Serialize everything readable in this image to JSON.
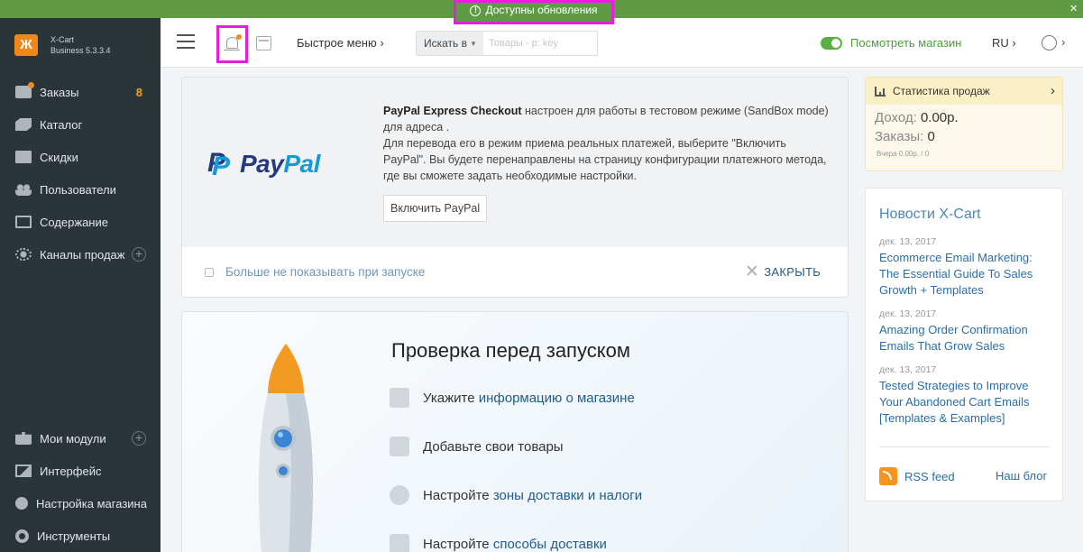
{
  "topbar": {
    "update_notice": "Доступны обновления",
    "close_glyph": "×"
  },
  "brand": {
    "logo_glyph": "Ж",
    "line1": "X-Cart",
    "line2": "Business 5.3.3.4"
  },
  "sidebar": {
    "items": [
      {
        "label": "Заказы",
        "badge": "8",
        "icon": "orders-icon"
      },
      {
        "label": "Каталог",
        "icon": "tag-icon"
      },
      {
        "label": "Скидки",
        "icon": "gift-icon"
      },
      {
        "label": "Пользователи",
        "icon": "users-icon"
      },
      {
        "label": "Содержание",
        "icon": "content-icon"
      },
      {
        "label": "Каналы продаж",
        "icon": "sales-channels-icon",
        "plus": "+"
      }
    ],
    "bottom_items": [
      {
        "label": "Мои модули",
        "icon": "puzzle-icon",
        "plus": "+"
      },
      {
        "label": "Интерфейс",
        "icon": "image-icon"
      },
      {
        "label": "Настройка магазина",
        "icon": "info-icon"
      },
      {
        "label": "Инструменты",
        "icon": "gear-icon"
      }
    ]
  },
  "header": {
    "quick_menu": "Быстрое меню ›",
    "search_type": "Искать в",
    "search_placeholder": "Товары - p: key",
    "view_store": "Посмотреть магазин",
    "lang": "RU ›",
    "user_chevron": "›"
  },
  "paypal": {
    "title": "PayPal Express Checkout",
    "line1_rest": " настроен для работы в тестовом режиме (SandBox mode) для адреса .",
    "line2": "Для перевода его в режим приема реальных платежей, выберите \"Включить PayPal\". Вы будете перенаправлены на страницу конфигурации платежного метода, где вы сможете задать необходимые настройки.",
    "enable_button": "Включить PayPal",
    "dont_show": "Больше не показывать при запуске",
    "close": "ЗАКРЫТЬ",
    "logo_word_dark": "Pay",
    "logo_word_light": "Pal"
  },
  "launch": {
    "title": "Проверка перед запуском",
    "items": [
      {
        "prefix": "Укажите ",
        "link": "информацию о магазине"
      },
      {
        "prefix": "Добавьте свои товары",
        "link": ""
      },
      {
        "prefix": "Настройте ",
        "link": "зоны доставки и налоги"
      },
      {
        "prefix": "Настройте ",
        "link": "способы доставки"
      }
    ]
  },
  "sales": {
    "title": "Статистика продаж",
    "income_label": "Доход:",
    "income_value": "0.00р.",
    "orders_label": "Заказы:",
    "orders_value": "0",
    "yesterday": "Вчера 0.00р. / 0"
  },
  "news": {
    "title": "Новости X-Cart",
    "items": [
      {
        "date": "дек. 13, 2017",
        "title": "Ecommerce Email Marketing: The Essential Guide To Sales Growth + Templates"
      },
      {
        "date": "дек. 13, 2017",
        "title": "Amazing Order Confirmation Emails That Grow Sales"
      },
      {
        "date": "дек. 13, 2017",
        "title": "Tested Strategies to Improve Your Abandoned Cart Emails [Templates & Examples]"
      }
    ],
    "rss": "RSS feed",
    "blog": "Наш блог"
  },
  "colors": {
    "accent_green": "#5f9b45",
    "highlight_magenta": "#e81fd8",
    "sidebar_bg": "#2a3439",
    "link_blue": "#2a6eaa",
    "badge_orange": "#f0a020"
  }
}
